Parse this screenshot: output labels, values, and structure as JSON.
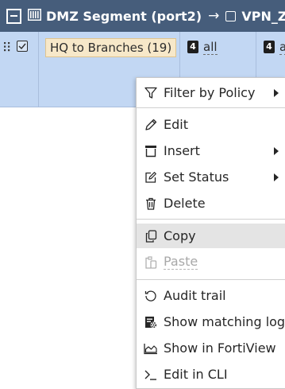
{
  "section_header": {
    "source": "DMZ Segment (port2)",
    "arrow": "→",
    "destination": "VPN_Zone"
  },
  "policy_row": {
    "name": "HQ to Branches (19)",
    "service_1": "all",
    "service_2": "a",
    "badge_1": "4",
    "badge_2": "4"
  },
  "context_menu": {
    "filter_by_policy": "Filter by Policy",
    "edit": "Edit",
    "insert": "Insert",
    "set_status": "Set Status",
    "delete": "Delete",
    "copy": "Copy",
    "paste": "Paste",
    "audit_trail": "Audit trail",
    "show_matching_logs": "Show matching logs",
    "show_in_fortiview": "Show in FortiView",
    "edit_in_cli": "Edit in CLI"
  },
  "colors": {
    "header_bg": "#465d7b",
    "row_selected_bg": "#c2d7f3",
    "policy_name_bg": "#f7e8c9",
    "menu_hover_bg": "#e4e4e4"
  }
}
